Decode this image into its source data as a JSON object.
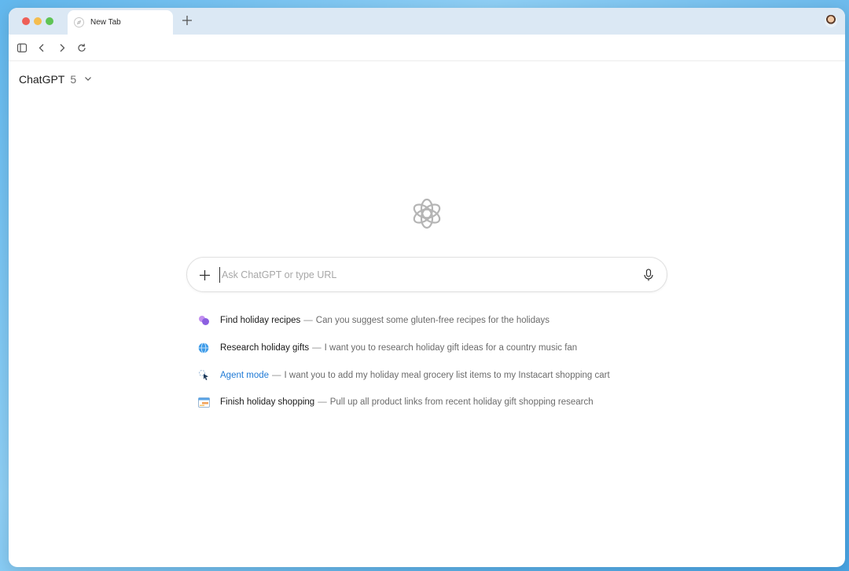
{
  "tab": {
    "title": "New Tab"
  },
  "toolbar": {},
  "model": {
    "name": "ChatGPT",
    "version": "5"
  },
  "search": {
    "placeholder": "Ask ChatGPT or type URL",
    "value": ""
  },
  "suggestions": [
    {
      "title": "Find holiday recipes",
      "separator": "—",
      "description": "Can you suggest some gluten-free recipes for the holidays",
      "icon": "bubbles-icon"
    },
    {
      "title": "Research holiday gifts",
      "separator": "—",
      "description": "I want you to research holiday gift ideas for a country music fan",
      "icon": "globe-icon"
    },
    {
      "title": "Agent mode",
      "separator": "—",
      "description": "I want you to add my holiday meal grocery list items to my Instacart shopping cart",
      "icon": "agent-cursor-icon",
      "accent": "#1f7ad6"
    },
    {
      "title": "Finish holiday shopping",
      "separator": "—",
      "description": "Pull up all product links from recent holiday gift shopping research",
      "icon": "browser-tabs-icon"
    }
  ],
  "colors": {
    "accent": "#1f7ad6",
    "tabbar": "#dbe8f4",
    "background": "#62b8ee"
  }
}
